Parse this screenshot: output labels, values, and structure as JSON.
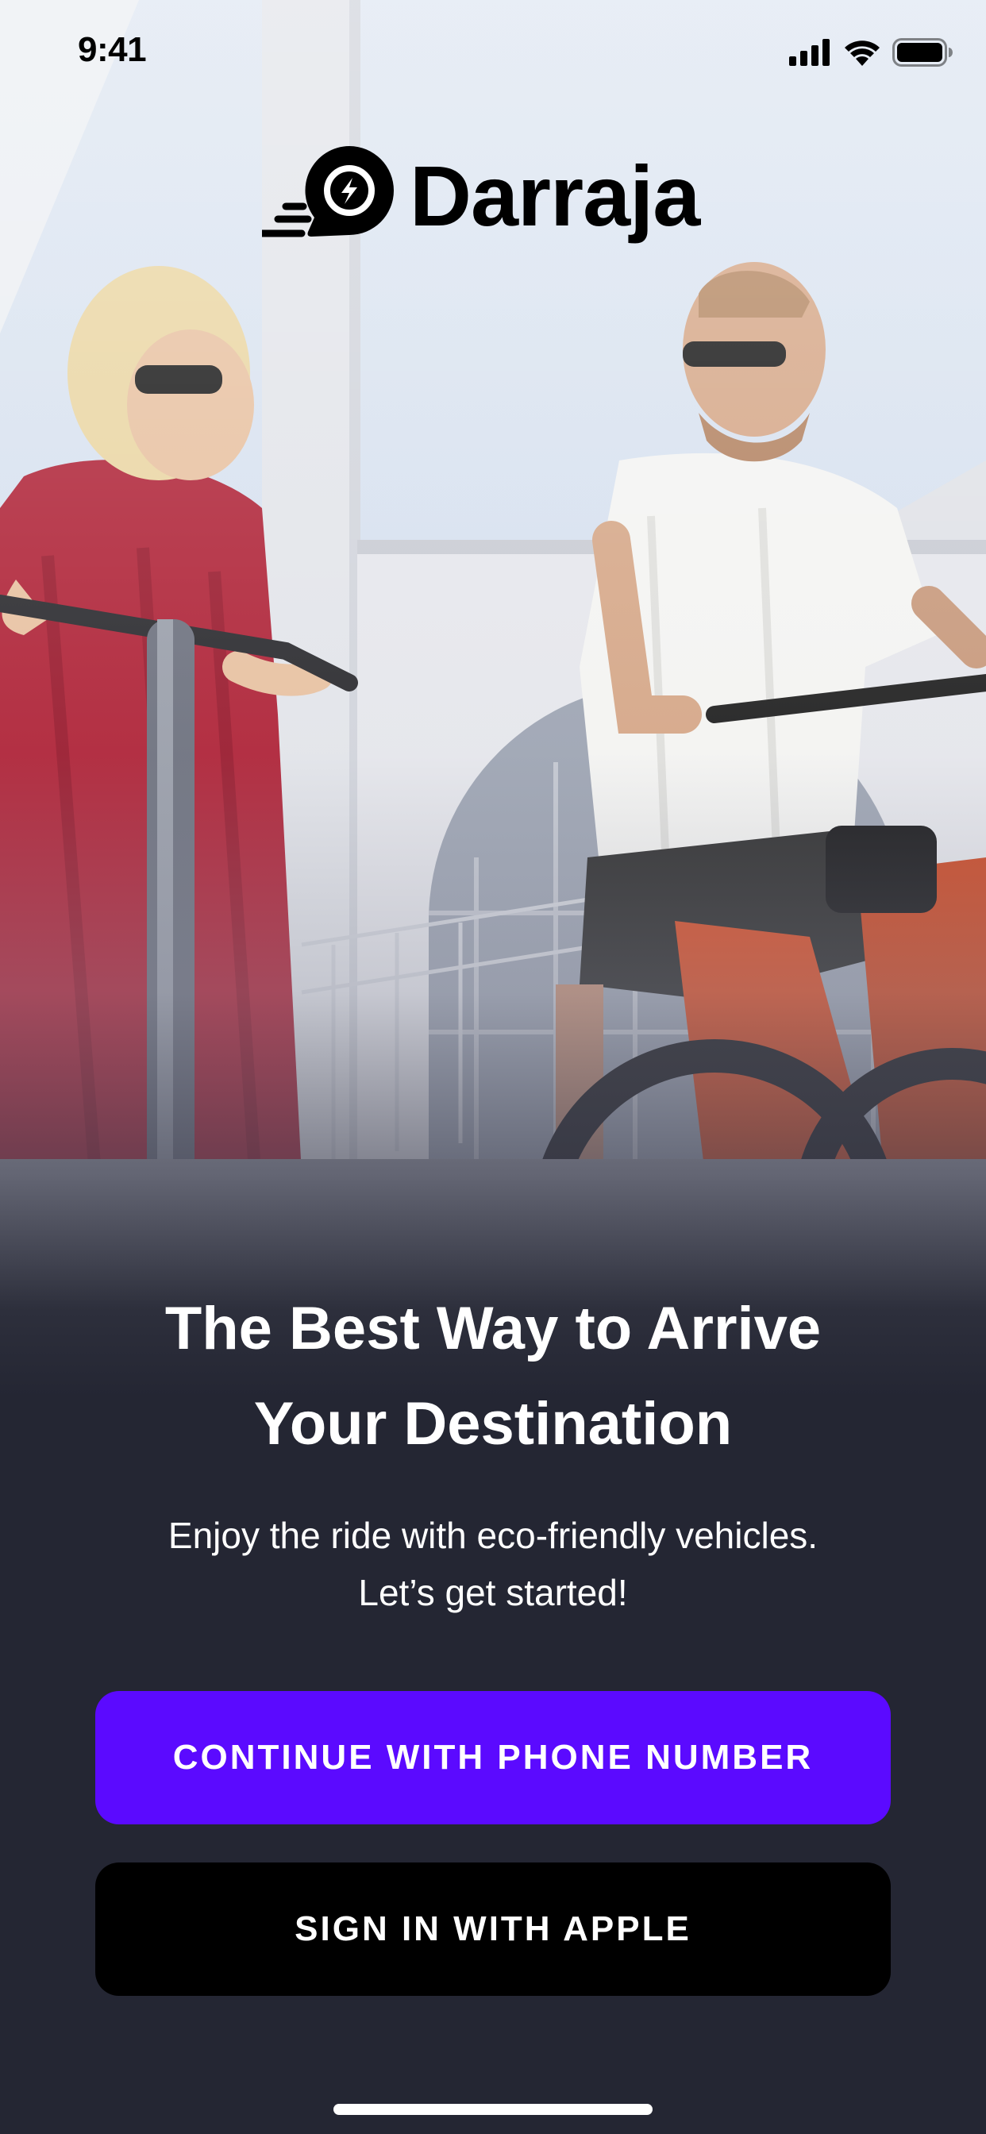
{
  "status_bar": {
    "time": "9:41",
    "icons": [
      "cellular-signal-icon",
      "wifi-icon",
      "battery-icon"
    ]
  },
  "logo": {
    "icon": "speed-pin-icon",
    "text": "Darraja"
  },
  "hero": {
    "image": "people-riding-electric-scooters-photo",
    "headline_line1": "The Best Way to Arrive",
    "headline_line2": "Your Destination",
    "subline_line1": "Enjoy the ride with eco-friendly vehicles.",
    "subline_line2": "Let’s get started!"
  },
  "actions": {
    "phone_label": "CONTINUE WITH PHONE NUMBER",
    "apple_label": "SIGN IN WITH APPLE"
  },
  "colors": {
    "accent": "#5B0AFF",
    "background": "#242633",
    "apple_button": "#000000",
    "text": "#FFFFFF"
  }
}
